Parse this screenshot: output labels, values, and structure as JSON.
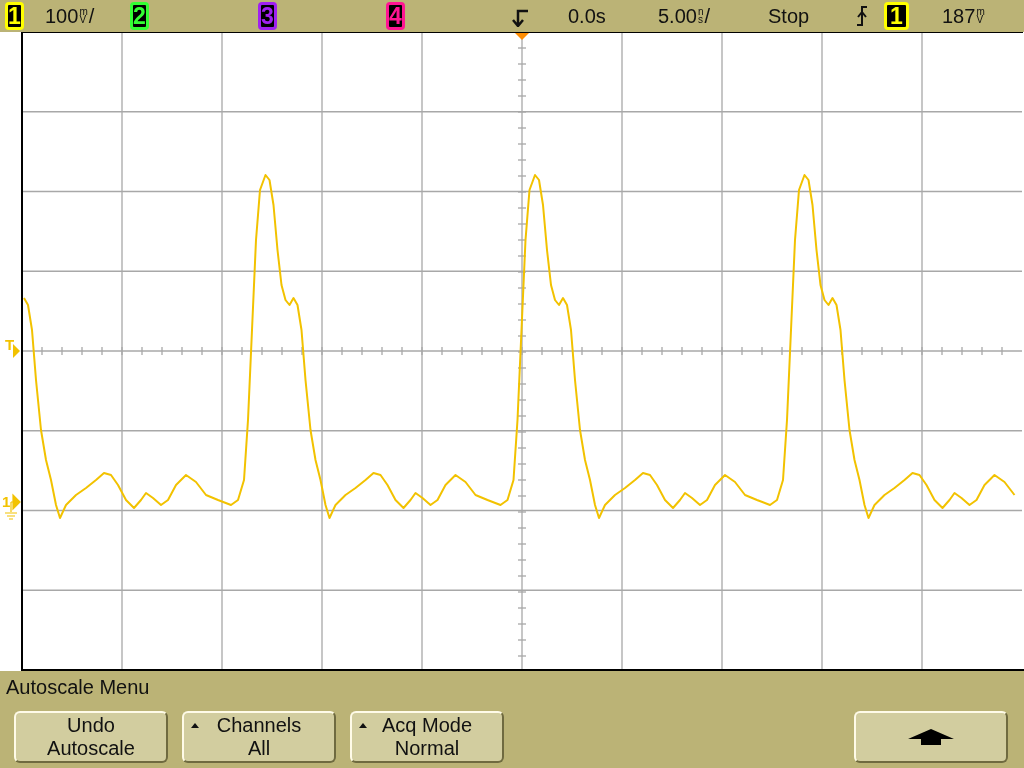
{
  "status_bar": {
    "items": [
      {
        "kind": "channel",
        "label": "1",
        "color": "#ffff00"
      },
      {
        "kind": "scale",
        "value": "100",
        "unit_top": "m",
        "unit_bottom": "V",
        "suffix": "/"
      },
      {
        "kind": "channel",
        "label": "2",
        "color": "#33ff33"
      },
      {
        "kind": "channel",
        "label": "3",
        "color": "#a020f0"
      },
      {
        "kind": "channel",
        "label": "4",
        "color": "#ff1493"
      },
      {
        "kind": "delay-icon"
      },
      {
        "kind": "text",
        "text": "0.0s"
      },
      {
        "kind": "scale",
        "value": "5.00",
        "unit_top": "n",
        "unit_bottom": "s",
        "suffix": "/"
      },
      {
        "kind": "text",
        "text": "Stop"
      },
      {
        "kind": "edge-icon"
      },
      {
        "kind": "source",
        "label": "1",
        "color": "#ffff00"
      },
      {
        "kind": "scale",
        "value": "187",
        "unit_top": "m",
        "unit_bottom": "V"
      }
    ]
  },
  "display": {
    "markers": [
      {
        "kind": "trigger-level",
        "label": "T"
      },
      {
        "kind": "ground",
        "label": "1"
      }
    ]
  },
  "softkey_menu": {
    "title": "Autoscale Menu",
    "buttons": [
      {
        "kind": "action",
        "lines": [
          "Undo",
          "Autoscale"
        ]
      },
      {
        "kind": "cycle",
        "lines": [
          "Channels",
          "All"
        ]
      },
      {
        "kind": "cycle",
        "lines": [
          "Acq Mode",
          "Normal"
        ]
      },
      {
        "kind": "arrow"
      }
    ]
  }
}
